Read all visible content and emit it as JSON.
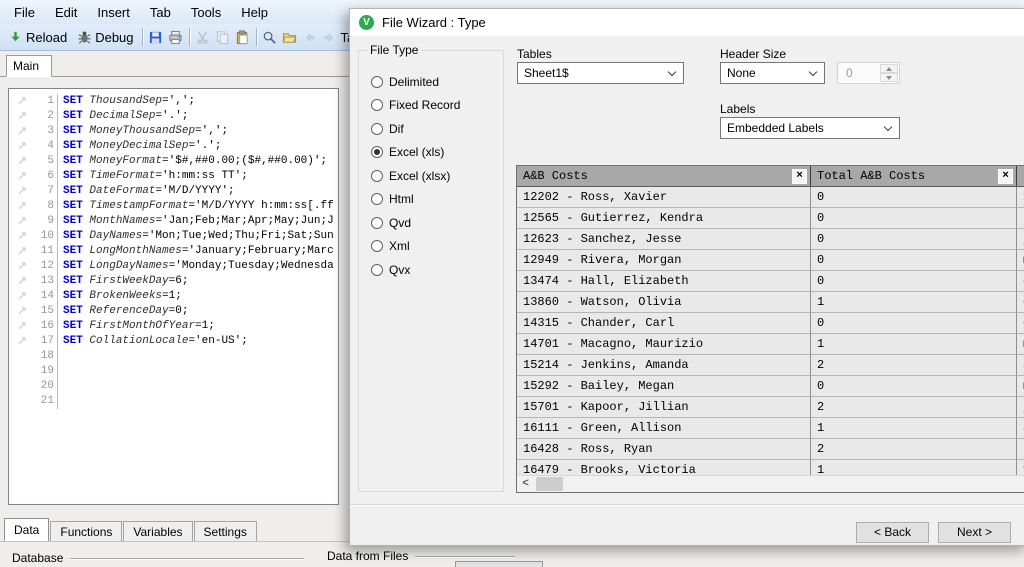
{
  "window": {
    "menu_items": [
      "File",
      "Edit",
      "Insert",
      "Tab",
      "Tools",
      "Help"
    ],
    "toolbar": {
      "reload_label": "Reload",
      "debug_label": "Debug",
      "clipped_label": "Ta",
      "icon_names": [
        "reload-icon",
        "debug-icon",
        "save-icon",
        "print-icon",
        "cut-icon",
        "copy-icon",
        "paste-icon",
        "search-icon",
        "open-folder-icon",
        "back-icon",
        "forward-icon"
      ]
    },
    "editor_tab": "Main",
    "bottom_tabs": [
      "Data",
      "Functions",
      "Variables",
      "Settings"
    ],
    "status_groups": [
      "Database",
      "Data from Files"
    ]
  },
  "script": {
    "keyword": "SET",
    "lines": [
      {
        "num": 1,
        "variable": "ThousandSep",
        "value": "=',';"
      },
      {
        "num": 2,
        "variable": "DecimalSep",
        "value": "='.';"
      },
      {
        "num": 3,
        "variable": "MoneyThousandSep",
        "value": "=',';"
      },
      {
        "num": 4,
        "variable": "MoneyDecimalSep",
        "value": "='.';"
      },
      {
        "num": 5,
        "variable": "MoneyFormat",
        "value": "='$#,##0.00;($#,##0.00)';"
      },
      {
        "num": 6,
        "variable": "TimeFormat",
        "value": "='h:mm:ss TT';"
      },
      {
        "num": 7,
        "variable": "DateFormat",
        "value": "='M/D/YYYY';"
      },
      {
        "num": 8,
        "variable": "TimestampFormat",
        "value": "='M/D/YYYY h:mm:ss[.ff"
      },
      {
        "num": 9,
        "variable": "MonthNames",
        "value": "='Jan;Feb;Mar;Apr;May;Jun;J"
      },
      {
        "num": 10,
        "variable": "DayNames",
        "value": "='Mon;Tue;Wed;Thu;Fri;Sat;Sun"
      },
      {
        "num": 11,
        "variable": "LongMonthNames",
        "value": "='January;February;Marc"
      },
      {
        "num": 12,
        "variable": "LongDayNames",
        "value": "='Monday;Tuesday;Wednesda"
      },
      {
        "num": 13,
        "variable": "FirstWeekDay",
        "value": "=6;"
      },
      {
        "num": 14,
        "variable": "BrokenWeeks",
        "value": "=1;"
      },
      {
        "num": 15,
        "variable": "ReferenceDay",
        "value": "=0;"
      },
      {
        "num": 16,
        "variable": "FirstMonthOfYear",
        "value": "=1;"
      },
      {
        "num": 17,
        "variable": "CollationLocale",
        "value": "='en-US';"
      }
    ],
    "empty_line_numbers": [
      18,
      19,
      20,
      21
    ]
  },
  "dialog": {
    "title": "File Wizard : Type",
    "logo_letter": "V",
    "file_type": {
      "label": "File Type",
      "options": [
        "Delimited",
        "Fixed Record",
        "Dif",
        "Excel (xls)",
        "Excel (xlsx)",
        "Html",
        "Qvd",
        "Xml",
        "Qvx"
      ],
      "selected": "Excel (xls)"
    },
    "tables": {
      "label": "Tables",
      "value": "Sheet1$"
    },
    "header_size": {
      "label": "Header Size",
      "value": "None",
      "spin_value": "0"
    },
    "labels_field": {
      "label": "Labels",
      "value": "Embedded Labels"
    },
    "preview": {
      "columns": [
        "A&B Costs",
        "Total A&B Costs",
        "E"
      ],
      "rows": [
        [
          "12202 - Ross, Xavier",
          "0",
          "x"
        ],
        [
          "12565 - Gutierrez, Kendra",
          "0",
          "k"
        ],
        [
          "12623 - Sanchez, Jesse",
          "0",
          "j"
        ],
        [
          "12949 - Rivera, Morgan",
          "0",
          "m"
        ],
        [
          "13474 - Hall, Elizabeth",
          "0",
          "e"
        ],
        [
          "13860 - Watson, Olivia",
          "1",
          "o"
        ],
        [
          "14315 - Chander, Carl",
          "0",
          "c"
        ],
        [
          "14701 - Macagno, Maurizio",
          "1",
          "m"
        ],
        [
          "15214 - Jenkins, Amanda",
          "2",
          "a"
        ],
        [
          "15292 - Bailey, Megan",
          "0",
          "m"
        ],
        [
          "15701 - Kapoor, Jillian",
          "2",
          "j"
        ],
        [
          "16111 - Green, Allison",
          "1",
          "a"
        ],
        [
          "16428 - Ross, Ryan",
          "2",
          "r"
        ],
        [
          "16479 - Brooks, Victoria",
          "1",
          "v"
        ]
      ]
    },
    "back_label": "< Back",
    "next_label": "Next >"
  },
  "icons": {
    "bookmark_arrow": "↗",
    "remove": "×",
    "scroll_left": "<"
  },
  "colors": {
    "logo_green": "#2ea84e",
    "keyword_blue": "#0000cd",
    "table_header_gray": "#a8a8a8",
    "table_row_gray": "#e9e9e9",
    "toolbar_blue": "#d9e7f7"
  }
}
